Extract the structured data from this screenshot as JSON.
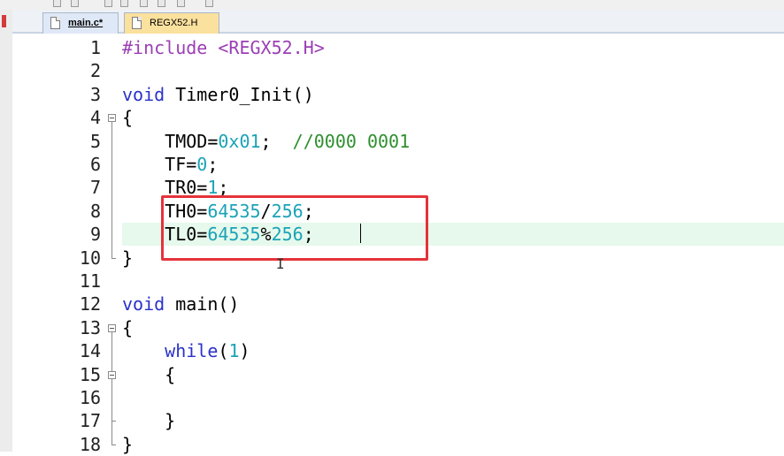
{
  "tabs": [
    {
      "label": "main.c*",
      "active": true,
      "icon": "c-file-icon"
    },
    {
      "label": "REGX52.H",
      "active": false,
      "icon": "header-file-icon"
    }
  ],
  "colors": {
    "keyword": "#2a32c8",
    "number": "#1ba3b7",
    "comment": "#2f8f2f",
    "preprocessor": "#9b3fb5",
    "highlight_box": "#e5333b",
    "current_line": "#e6f9ec"
  },
  "editor": {
    "current_line": 9,
    "lines": [
      {
        "n": "1",
        "tokens": [
          {
            "t": "pp",
            "v": "#include <REGX52.H>"
          }
        ]
      },
      {
        "n": "2",
        "tokens": []
      },
      {
        "n": "3",
        "tokens": [
          {
            "t": "kw",
            "v": "void"
          },
          {
            "t": "txt",
            "v": " Timer0_Init()"
          }
        ]
      },
      {
        "n": "4",
        "tokens": [
          {
            "t": "txt",
            "v": "{"
          }
        ]
      },
      {
        "n": "5",
        "tokens": [
          {
            "t": "txt",
            "v": "    TMOD="
          },
          {
            "t": "num",
            "v": "0x01"
          },
          {
            "t": "txt",
            "v": ";  "
          },
          {
            "t": "cmt",
            "v": "//0000 0001"
          }
        ]
      },
      {
        "n": "6",
        "tokens": [
          {
            "t": "txt",
            "v": "    TF="
          },
          {
            "t": "num",
            "v": "0"
          },
          {
            "t": "txt",
            "v": ";"
          }
        ]
      },
      {
        "n": "7",
        "tokens": [
          {
            "t": "txt",
            "v": "    TR0="
          },
          {
            "t": "num",
            "v": "1"
          },
          {
            "t": "txt",
            "v": ";"
          }
        ]
      },
      {
        "n": "8",
        "tokens": [
          {
            "t": "txt",
            "v": "    TH0="
          },
          {
            "t": "num",
            "v": "64535"
          },
          {
            "t": "txt",
            "v": "/"
          },
          {
            "t": "num",
            "v": "256"
          },
          {
            "t": "txt",
            "v": ";"
          }
        ]
      },
      {
        "n": "9",
        "tokens": [
          {
            "t": "txt",
            "v": "    TL0="
          },
          {
            "t": "num",
            "v": "64535"
          },
          {
            "t": "txt",
            "v": "%"
          },
          {
            "t": "num",
            "v": "256"
          },
          {
            "t": "txt",
            "v": ";"
          }
        ]
      },
      {
        "n": "10",
        "tokens": [
          {
            "t": "txt",
            "v": "}"
          }
        ]
      },
      {
        "n": "11",
        "tokens": []
      },
      {
        "n": "12",
        "tokens": [
          {
            "t": "kw",
            "v": "void"
          },
          {
            "t": "txt",
            "v": " main()"
          }
        ]
      },
      {
        "n": "13",
        "tokens": [
          {
            "t": "txt",
            "v": "{"
          }
        ]
      },
      {
        "n": "14",
        "tokens": [
          {
            "t": "txt",
            "v": "    "
          },
          {
            "t": "kw",
            "v": "while"
          },
          {
            "t": "txt",
            "v": "("
          },
          {
            "t": "num",
            "v": "1"
          },
          {
            "t": "txt",
            "v": ")"
          }
        ]
      },
      {
        "n": "15",
        "tokens": [
          {
            "t": "txt",
            "v": "    {"
          }
        ]
      },
      {
        "n": "16",
        "tokens": []
      },
      {
        "n": "17",
        "tokens": [
          {
            "t": "txt",
            "v": "    }"
          }
        ]
      },
      {
        "n": "18",
        "tokens": [
          {
            "t": "txt",
            "v": "}"
          }
        ]
      }
    ]
  }
}
